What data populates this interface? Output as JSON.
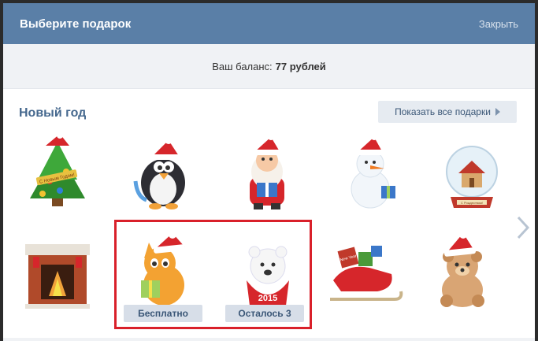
{
  "header": {
    "title": "Выберите подарок",
    "close_label": "Закрыть"
  },
  "balance": {
    "label": "Ваш баланс:",
    "amount": "77 рублей"
  },
  "section": {
    "title": "Новый год",
    "show_all_label": "Показать все подарки"
  },
  "gifts_row1": [
    {
      "name": "christmas-tree-gift",
      "tag": "С Новым Годом!"
    },
    {
      "name": "penguin-santa-gift"
    },
    {
      "name": "santa-claus-gift"
    },
    {
      "name": "snowman-gift"
    },
    {
      "name": "snow-globe-gift",
      "tag": "С Рождеством!"
    }
  ],
  "gifts_row2": [
    {
      "name": "fireplace-gift"
    },
    {
      "name": "cat-santa-gift",
      "badge": "Бесплатно"
    },
    {
      "name": "bear-2015-gift",
      "badge": "Осталось 3",
      "text": "2015"
    },
    {
      "name": "sleigh-gift",
      "tag": "New Year"
    },
    {
      "name": "teddy-bear-santa-gift"
    }
  ],
  "colors": {
    "header_bg": "#5a7fa7",
    "accent_text": "#45688e",
    "highlight_border": "#d9202a"
  }
}
